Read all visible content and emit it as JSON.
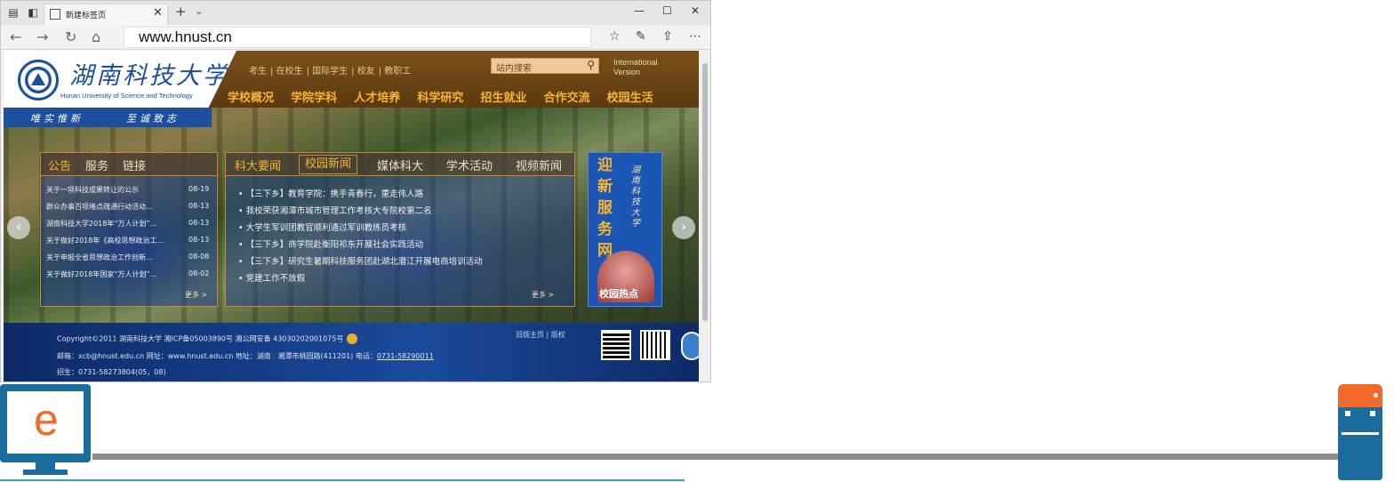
{
  "browser": {
    "tab_title": "新建标签页",
    "address": "www.hnust.cn",
    "icons": {
      "tab_manager": "tab-manager-icon",
      "set_aside": "set-aside-icon",
      "new_tab": "plus-icon",
      "tab_list": "chevron-down-icon",
      "minimize": "minimize-icon",
      "maximize": "maximize-icon",
      "close": "close-icon",
      "back": "back-arrow-icon",
      "forward": "forward-arrow-icon",
      "refresh": "refresh-icon",
      "home": "home-icon",
      "favorites": "favorites-star-icon",
      "web_note": "pen-icon",
      "share": "share-icon",
      "more": "more-dots-icon"
    }
  },
  "site": {
    "logo_cn": "湖南科技大学",
    "logo_en": "Hunan University of Science and Technology",
    "quick_links": [
      "考生",
      "在校生",
      "国际学生",
      "校友",
      "教职工"
    ],
    "search_placeholder": "站内搜索",
    "intl_line1": "International",
    "intl_line2": "Version",
    "nav": [
      "学校概况",
      "学院学科",
      "人才培养",
      "科学研究",
      "招生就业",
      "合作交流",
      "校园生活"
    ],
    "slogan_left": "唯实惟新",
    "slogan_right": "至诚致志",
    "notice": {
      "tabs": [
        "公告",
        "服务",
        "链接"
      ],
      "items": [
        {
          "title": "关于一项科技成果转让的公示",
          "date": "08-19"
        },
        {
          "title": "群众办事百项堵点疏通行动活动…",
          "date": "08-13"
        },
        {
          "title": "湖南科技大学2018年“万人计划”…",
          "date": "08-13"
        },
        {
          "title": "关于做好2018年《高校思想政治工…",
          "date": "08-13"
        },
        {
          "title": "关于申报全省思想政治工作创新…",
          "date": "08-08"
        },
        {
          "title": "关于做好2018年国家“万人计划”…",
          "date": "08-02"
        }
      ],
      "more": "更多 >"
    },
    "news": {
      "tabs": [
        "科大要闻",
        "校园新闻",
        "媒体科大",
        "学术活动",
        "视频新闻"
      ],
      "items": [
        "【三下乡】教育学院：携手青春行，重走伟人路",
        "我校荣获湘潭市城市管理工作考核大专院校第二名",
        "大学生军训团教官顺利通过军训教练员考核",
        "【三下乡】商学院赴衡阳祁东开展社会实践活动",
        "【三下乡】研究生暑期科技服务团赴湖北潜江开展电商培训活动",
        "党建工作不放假"
      ],
      "more": "更多 >"
    },
    "promo": {
      "big": "迎新服务网",
      "small": "湖南科技大学",
      "label": "校园热点"
    },
    "footer": {
      "line1": "Copyright©2011 湖南科技大学 湘ICP备05003890号 湘公网安备 43030202001075号",
      "line2_prefix": "邮箱：xcb@hnust.edu.cn 网址：www.hnust.edu.cn 地址：湖南 · 湘潭市桃园路(411201) 电话：",
      "phone": "0731-58290011",
      "line3": "招生：0731-58273804(05，08)",
      "links": "旧版主页 | 版权"
    }
  },
  "colors": {
    "header_brown": "#6b4515",
    "nav_gold": "#f7b531",
    "school_blue": "#1b4fa0",
    "accent_orange": "#f26a2a",
    "accent_teal": "#1b6c9c"
  }
}
